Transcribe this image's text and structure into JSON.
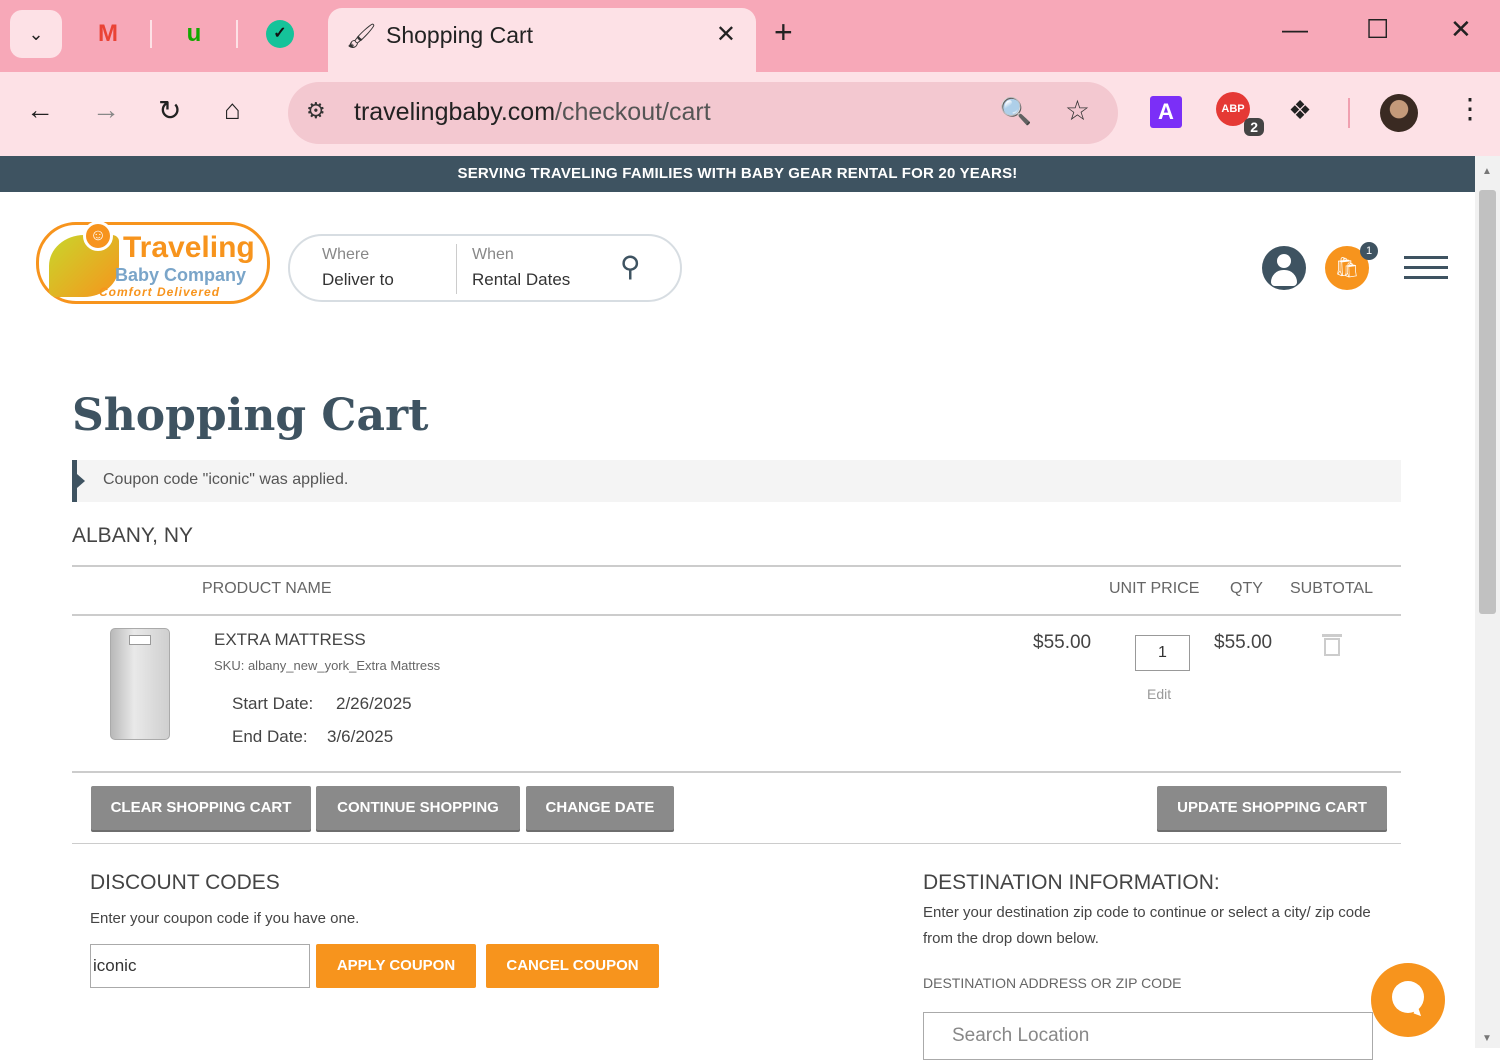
{
  "browser": {
    "tab_title": "Shopping Cart",
    "url_domain": "travelingbaby.com",
    "url_path": "/checkout/cart",
    "extension_badge": "2",
    "icons": [
      "chevron-down-icon",
      "gmail-icon",
      "upwork-icon",
      "grammarly-icon",
      "new-tab-icon",
      "minimize-icon",
      "maximize-icon",
      "close-icon",
      "back-icon",
      "forward-icon",
      "reload-icon",
      "home-icon",
      "site-info-icon",
      "zoom-icon",
      "bookmark-star-icon",
      "extension-a-icon",
      "adblock-icon",
      "puzzle-icon",
      "profile-avatar",
      "more-menu-icon"
    ]
  },
  "promo_banner": "SERVING TRAVELING FAMILIES WITH BABY GEAR RENTAL FOR 20 YEARS!",
  "logo": {
    "line1": "Traveling",
    "line2": "Baby Company",
    "tagline": "Comfort Delivered"
  },
  "search": {
    "where_label": "Where",
    "where_value": "Deliver to",
    "when_label": "When",
    "when_value": "Rental Dates"
  },
  "header": {
    "cart_count": "1"
  },
  "page": {
    "title": "Shopping Cart",
    "message": "Coupon code \"iconic\" was applied.",
    "location": "ALBANY, NY"
  },
  "table": {
    "headers": {
      "product_name": "PRODUCT NAME",
      "unit_price": "UNIT PRICE",
      "qty": "QTY",
      "subtotal": "SUBTOTAL"
    },
    "items": [
      {
        "name": "EXTRA MATTRESS",
        "sku": "SKU: albany_new_york_Extra Mattress",
        "start_label": "Start Date:",
        "start_value": "2/26/2025",
        "end_label": "End Date:",
        "end_value": "3/6/2025",
        "unit_price": "$55.00",
        "qty": "1",
        "edit_label": "Edit",
        "subtotal": "$55.00"
      }
    ]
  },
  "actions": {
    "clear": "CLEAR SHOPPING CART",
    "continue": "CONTINUE SHOPPING",
    "change_date": "CHANGE DATE",
    "update": "UPDATE SHOPPING CART"
  },
  "discount": {
    "title": "DISCOUNT CODES",
    "hint": "Enter your coupon code if you have one.",
    "code": "iconic",
    "apply": "APPLY COUPON",
    "cancel": "CANCEL COUPON"
  },
  "destination": {
    "title": "DESTINATION INFORMATION:",
    "text": "Enter your destination zip code to continue or select a city/ zip code from the drop down below.",
    "label": "DESTINATION ADDRESS OR ZIP CODE",
    "placeholder": "Search Location"
  },
  "colors": {
    "brand_dark": "#3e5361",
    "brand_orange": "#f7941d",
    "chrome_pink": "#f7a8b8",
    "button_gray": "#8a8a8a"
  }
}
